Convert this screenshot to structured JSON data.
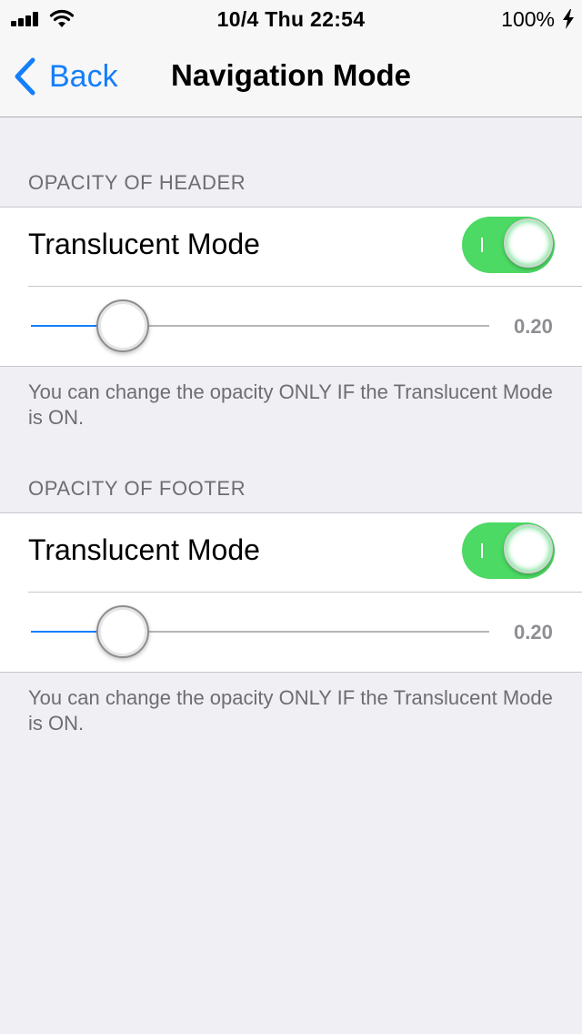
{
  "status_bar": {
    "time": "10/4 Thu 22:54",
    "battery": "100%",
    "icons": [
      "signal-icon",
      "wifi-icon",
      "charging-bolt-icon"
    ]
  },
  "nav": {
    "back_label": "Back",
    "title": "Navigation Mode"
  },
  "sections": [
    {
      "header": "OPACITY OF HEADER",
      "toggle_label": "Translucent Mode",
      "toggle_on": true,
      "slider_value": 0.2,
      "slider_label": "0.20",
      "footer": "You can change the opacity ONLY IF the Translucent Mode is ON."
    },
    {
      "header": "OPACITY OF FOOTER",
      "toggle_label": "Translucent Mode",
      "toggle_on": true,
      "slider_value": 0.2,
      "slider_label": "0.20",
      "footer": "You can change the opacity ONLY IF the Translucent Mode is ON."
    }
  ],
  "colors": {
    "accent": "#147efb",
    "toggle_on": "#4cd964",
    "background": "#efeff4"
  }
}
